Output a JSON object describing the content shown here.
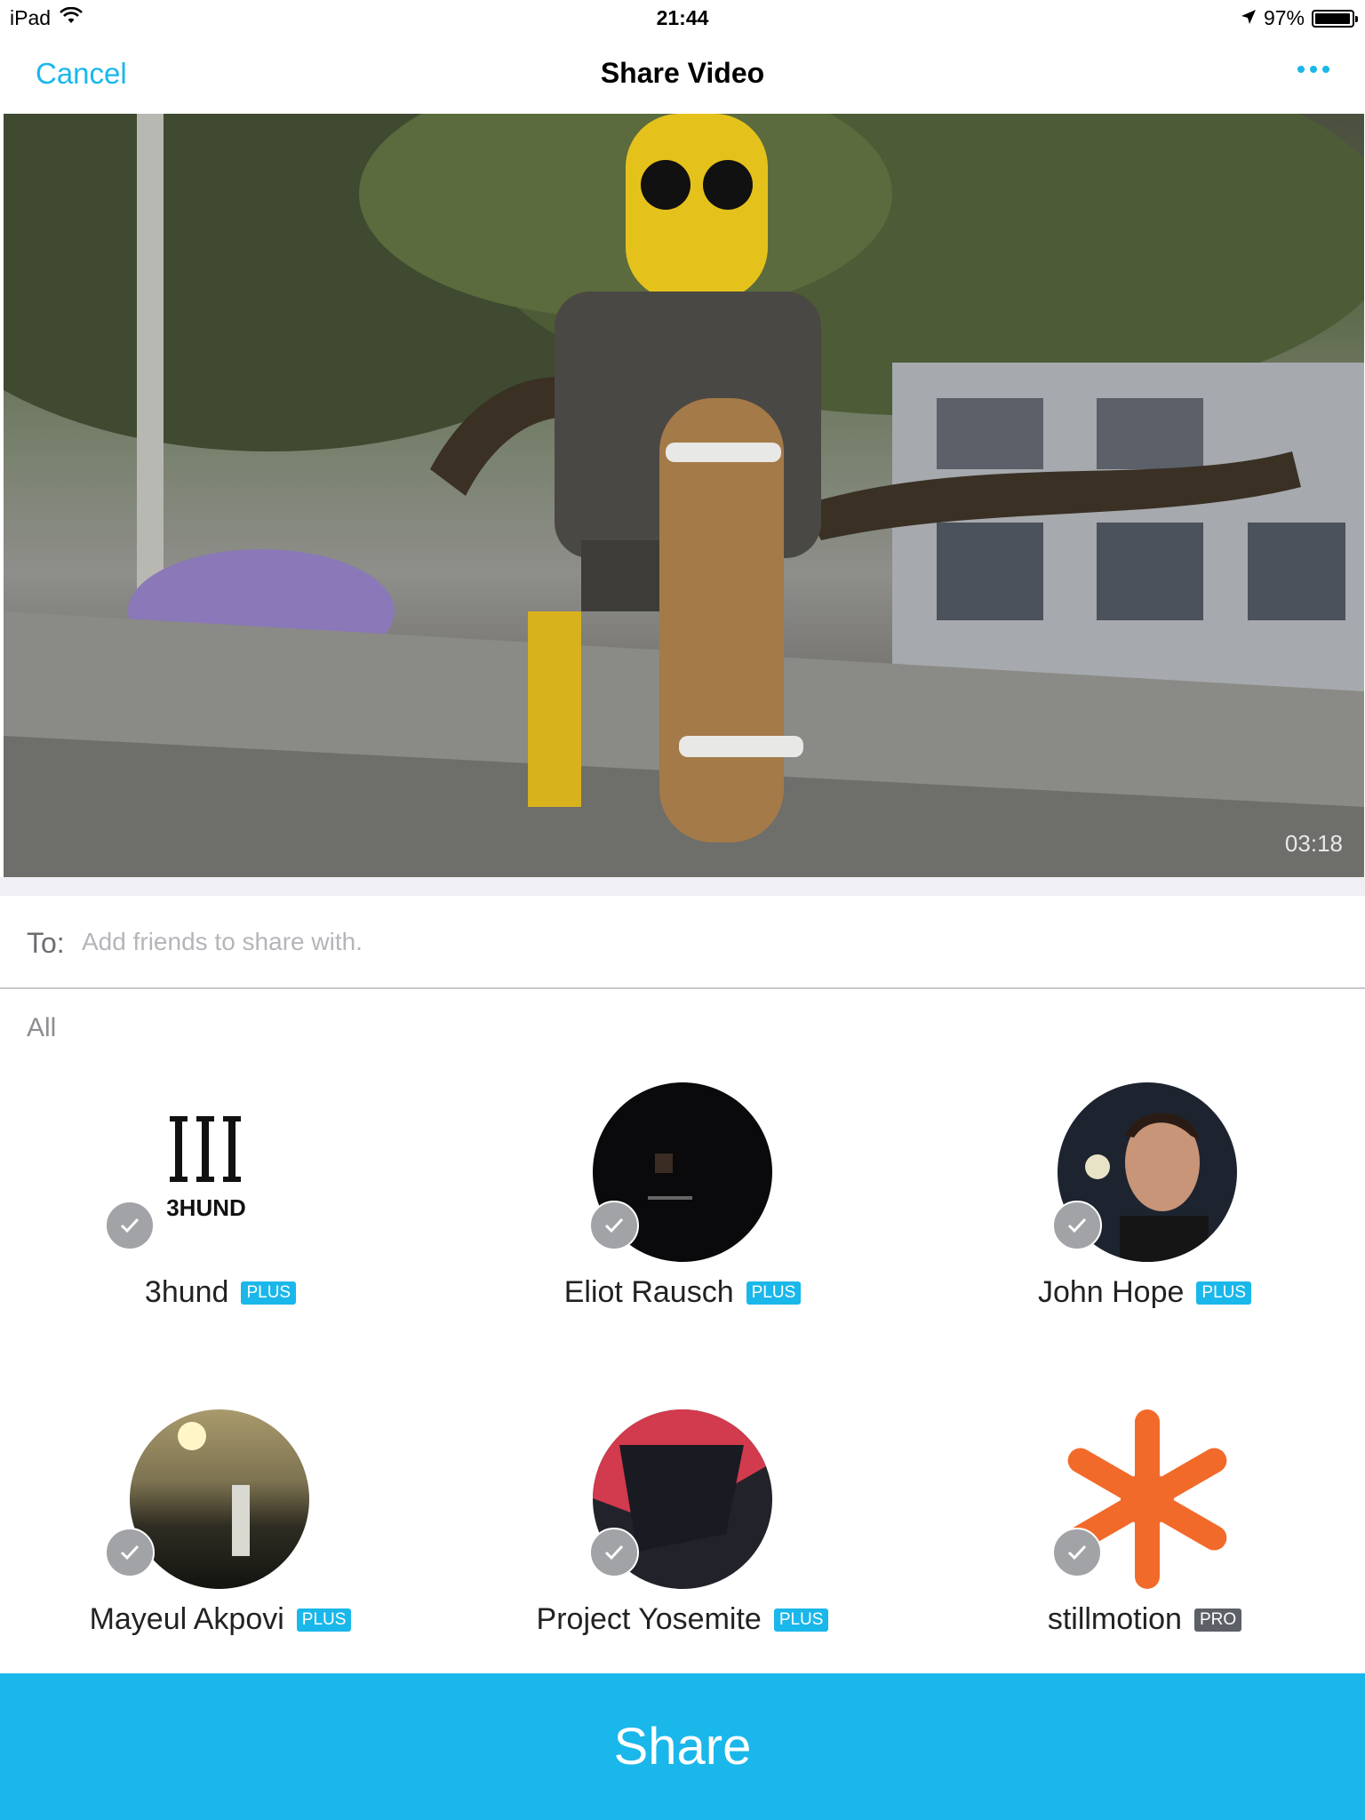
{
  "status_bar": {
    "device": "iPad",
    "time": "21:44",
    "battery": "97%",
    "battery_level": 0.97,
    "icons": [
      "wifi-icon",
      "location-arrow-icon",
      "battery-icon"
    ]
  },
  "nav": {
    "cancel_label": "Cancel",
    "title": "Share Video",
    "more_icon": "ellipsis-icon"
  },
  "video": {
    "duration": "03:18"
  },
  "to_field": {
    "label": "To:",
    "value": "",
    "placeholder": "Add friends to share with."
  },
  "section_label": "All",
  "contacts": [
    {
      "name": "3hund",
      "badge": "PLUS",
      "avatar": "3hund-logo"
    },
    {
      "name": "Eliot Rausch",
      "badge": "PLUS",
      "avatar": "dark-photo"
    },
    {
      "name": "John Hope",
      "badge": "PLUS",
      "avatar": "portrait-photo"
    },
    {
      "name": "Mayeul Akpovi",
      "badge": "PLUS",
      "avatar": "sunset-photo"
    },
    {
      "name": "Project Yosemite",
      "badge": "PLUS",
      "avatar": "project-yosemite-logo"
    },
    {
      "name": "stillmotion",
      "badge": "PRO",
      "avatar": "orange-asterisk-logo"
    }
  ],
  "colors": {
    "accent": "#1ab7ea",
    "pro_badge": "#5d6066",
    "check": "#a1a3a6"
  },
  "share_label": "Share"
}
